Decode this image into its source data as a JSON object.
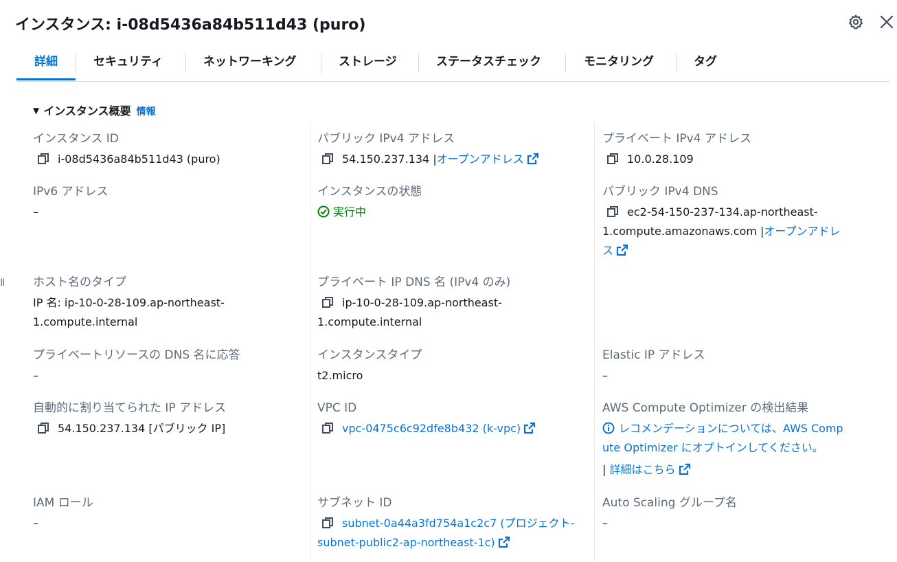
{
  "header": {
    "title": "インスタンス: i-08d5436a84b511d43 (puro)",
    "settings_icon": "gear-icon",
    "close_icon": "close-icon"
  },
  "tabs": [
    {
      "label": "詳細",
      "active": true
    },
    {
      "label": "セキュリティ"
    },
    {
      "label": "ネットワーキング"
    },
    {
      "label": "ストレージ"
    },
    {
      "label": "ステータスチェック"
    },
    {
      "label": "モニタリング"
    },
    {
      "label": "タグ"
    }
  ],
  "section": {
    "title": "インスタンス概要",
    "info": "情報"
  },
  "fields": {
    "instance_id": {
      "label": "インスタンス ID",
      "value": "i-08d5436a84b511d43 (puro)"
    },
    "public_ipv4": {
      "label": "パブリック IPv4 アドレス",
      "value": "54.150.237.134 |",
      "link": "オープンアドレス"
    },
    "private_ipv4": {
      "label": "プライベート IPv4 アドレス",
      "value": "10.0.28.109"
    },
    "ipv6": {
      "label": "IPv6 アドレス",
      "value": "–"
    },
    "instance_state": {
      "label": "インスタンスの状態",
      "value": "実行中"
    },
    "public_dns": {
      "label": "パブリック IPv4 DNS",
      "value_line1": "ec2-54-150-237-134.ap-northeast-",
      "value_line2": "1.compute.amazonaws.com |",
      "link_part1": "オープンアドレ",
      "link_part2": "ス"
    },
    "hostname_type": {
      "label": "ホスト名のタイプ",
      "value_line1": "IP 名: ip-10-0-28-109.ap-northeast-",
      "value_line2": "1.compute.internal"
    },
    "private_dns": {
      "label": "プライベート IP DNS 名 (IPv4 のみ)",
      "value_line1": "ip-10-0-28-109.ap-northeast-",
      "value_line2": "1.compute.internal"
    },
    "private_resource_dns": {
      "label": "プライベートリソースの DNS 名に応答",
      "value": "–"
    },
    "instance_type": {
      "label": "インスタンスタイプ",
      "value": "t2.micro"
    },
    "elastic_ip": {
      "label": "Elastic IP アドレス",
      "value": "–"
    },
    "auto_assigned_ip": {
      "label": "自動的に割り当てられた IP アドレス",
      "value": "54.150.237.134 [パブリック IP]"
    },
    "vpc_id": {
      "label": "VPC ID",
      "link": "vpc-0475c6c92dfe8b432 (k-vpc)"
    },
    "optimizer": {
      "label": "AWS Compute Optimizer の検出結果",
      "line1": "レコメンデーションについては、AWS Comp",
      "line2": "ute Optimizer にオプトインしてください。",
      "sep": "|",
      "more_link": "詳細はこちら"
    },
    "iam_role": {
      "label": "IAM ロール",
      "value": "–"
    },
    "subnet_id": {
      "label": "サブネット ID",
      "link_line1": "subnet-0a44a3fd754a1c2c7 (プロジェクト-",
      "link_line2": "subnet-public2-ap-northeast-1c)"
    },
    "asg_name": {
      "label": "Auto Scaling グループ名",
      "value": "–"
    }
  },
  "colors": {
    "link": "#0972d3",
    "success": "#037f0c",
    "label": "#5f6b7a",
    "text": "#16191f"
  }
}
